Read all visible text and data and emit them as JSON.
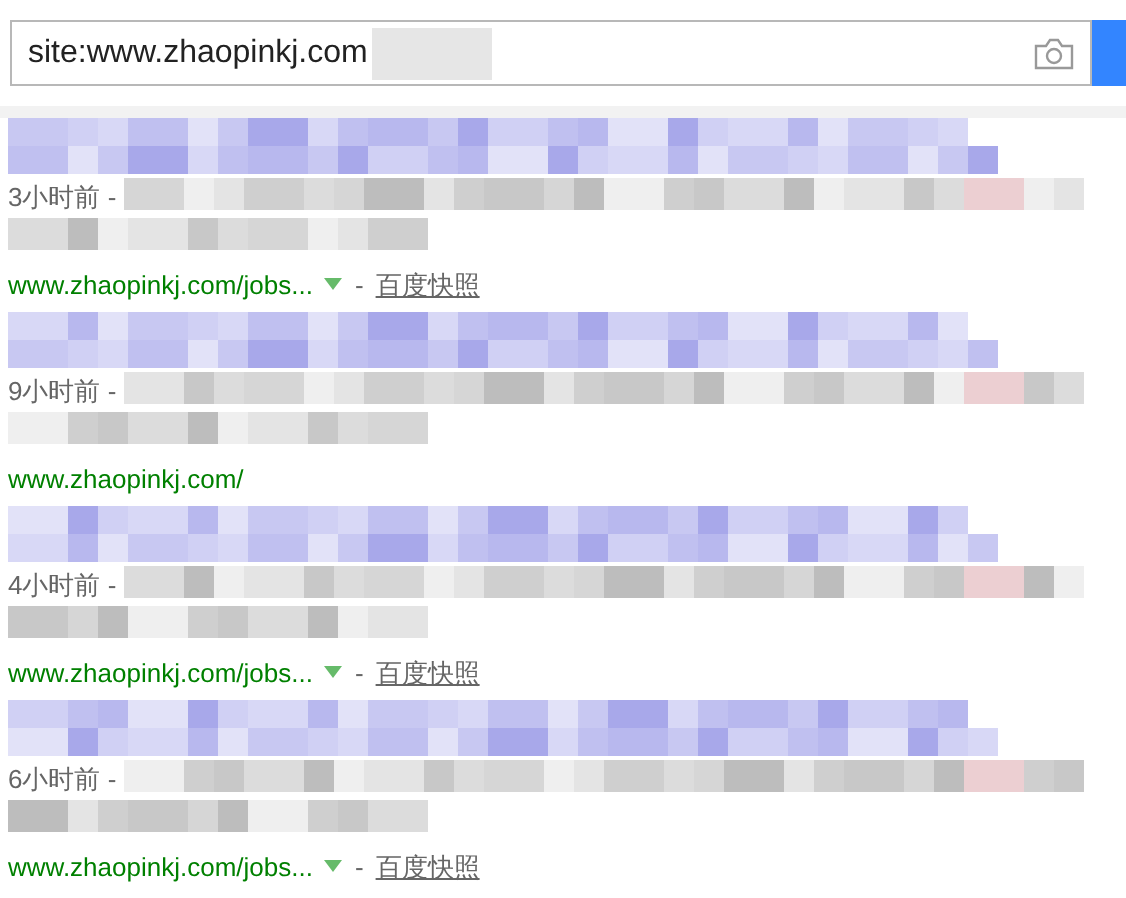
{
  "search": {
    "value": "site:www.zhaopinkj.com"
  },
  "results": [
    {
      "time": "3小时前 -",
      "url": "www.zhaopinkj.com/jobs...",
      "dropdown": true,
      "sep": "-",
      "snapshot": "百度快照"
    },
    {
      "time": "9小时前 -",
      "url": "www.zhaopinkj.com/"
    },
    {
      "time": "4小时前 -",
      "url": "www.zhaopinkj.com/jobs...",
      "dropdown": true,
      "sep": "-",
      "snapshot": "百度快照"
    },
    {
      "time": "6小时前 -",
      "url": "www.zhaopinkj.com/jobs...",
      "dropdown": true,
      "sep": "-",
      "snapshot": "百度快照"
    }
  ]
}
